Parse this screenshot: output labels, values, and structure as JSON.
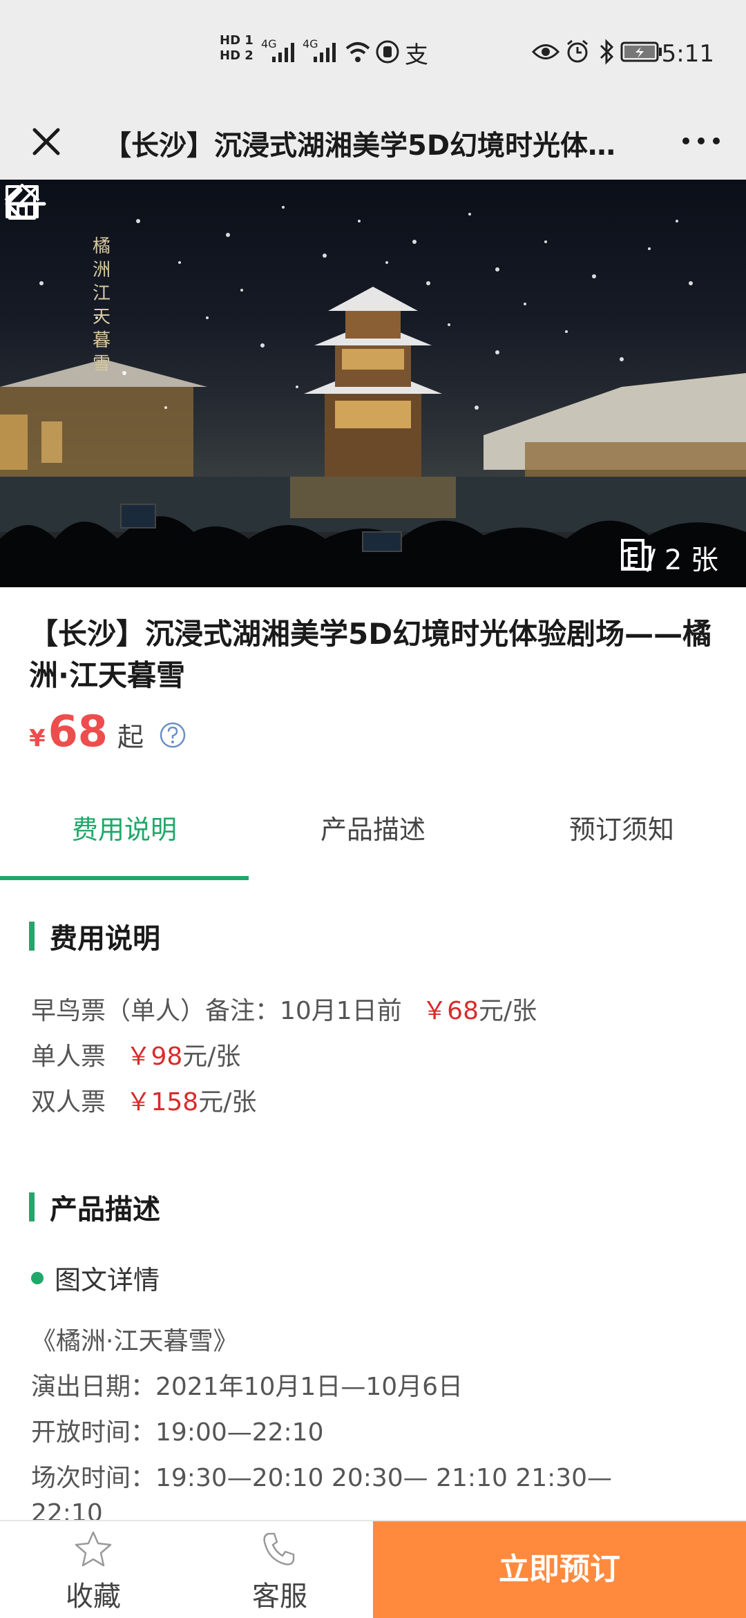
{
  "status_bar": {
    "network_1": "HD 1",
    "network_2": "HD 2",
    "signal_1": "4G",
    "signal_2": "4G",
    "alipay": "支",
    "time": "5:11"
  },
  "nav": {
    "title": "【长沙】沉浸式湖湘美学5D幻境时光体验剧场——橘洲·江天暮雪"
  },
  "hero": {
    "watermark": "橘洲江天暮雪",
    "counter": "1 / 2 张"
  },
  "product": {
    "title": "【长沙】沉浸式湖湘美学5D幻境时光体验剧场——橘洲·江天暮雪",
    "price_symbol": "¥",
    "price": "68",
    "price_suffix": "起"
  },
  "tabs": [
    {
      "label": "费用说明",
      "active": true
    },
    {
      "label": "产品描述",
      "active": false
    },
    {
      "label": "预订须知",
      "active": false
    }
  ],
  "fees": {
    "heading": "费用说明",
    "items": [
      {
        "name": "早鸟票（单人）备注：10月1日前",
        "price": "￥68",
        "unit": "元/张"
      },
      {
        "name": "单人票",
        "price": "￥98",
        "unit": "元/张"
      },
      {
        "name": "双人票",
        "price": "￥158",
        "unit": "元/张"
      }
    ]
  },
  "description": {
    "heading": "产品描述",
    "subheading": "图文详情",
    "lines": [
      "《橘洲·江天暮雪》",
      "演出日期：2021年10月1日—10月6日",
      "开放时间：19:00—22:10",
      "场次时间：19:30—20:10   20:30— 21:10   21:30—",
      "22:10"
    ]
  },
  "bottom_bar": {
    "favorite_label": "收藏",
    "service_label": "客服",
    "book_label": "立即预订"
  },
  "colors": {
    "accent_green": "#20a86a",
    "price_red": "#ee4d4d",
    "book_orange": "#ff8a3d"
  }
}
